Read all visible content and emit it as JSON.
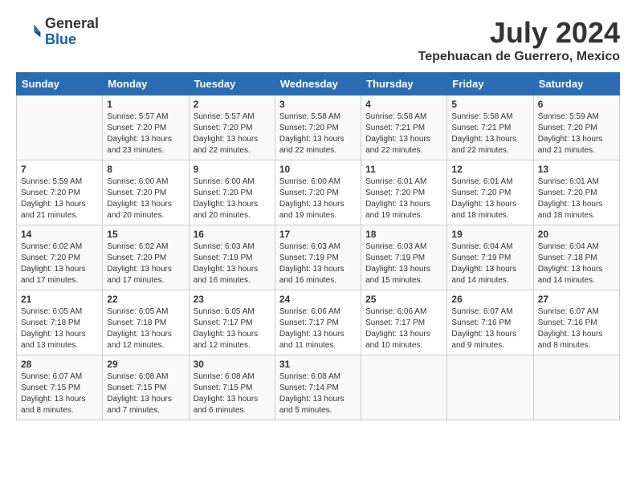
{
  "logo": {
    "general": "General",
    "blue": "Blue"
  },
  "header": {
    "month_year": "July 2024",
    "location": "Tepehuacan de Guerrero, Mexico"
  },
  "days_of_week": [
    "Sunday",
    "Monday",
    "Tuesday",
    "Wednesday",
    "Thursday",
    "Friday",
    "Saturday"
  ],
  "weeks": [
    [
      {
        "day": "",
        "info": ""
      },
      {
        "day": "1",
        "info": "Sunrise: 5:57 AM\nSunset: 7:20 PM\nDaylight: 13 hours\nand 23 minutes."
      },
      {
        "day": "2",
        "info": "Sunrise: 5:57 AM\nSunset: 7:20 PM\nDaylight: 13 hours\nand 22 minutes."
      },
      {
        "day": "3",
        "info": "Sunrise: 5:58 AM\nSunset: 7:20 PM\nDaylight: 13 hours\nand 22 minutes."
      },
      {
        "day": "4",
        "info": "Sunrise: 5:58 AM\nSunset: 7:21 PM\nDaylight: 13 hours\nand 22 minutes."
      },
      {
        "day": "5",
        "info": "Sunrise: 5:58 AM\nSunset: 7:21 PM\nDaylight: 13 hours\nand 22 minutes."
      },
      {
        "day": "6",
        "info": "Sunrise: 5:59 AM\nSunset: 7:20 PM\nDaylight: 13 hours\nand 21 minutes."
      }
    ],
    [
      {
        "day": "7",
        "info": "Sunrise: 5:59 AM\nSunset: 7:20 PM\nDaylight: 13 hours\nand 21 minutes."
      },
      {
        "day": "8",
        "info": "Sunrise: 6:00 AM\nSunset: 7:20 PM\nDaylight: 13 hours\nand 20 minutes."
      },
      {
        "day": "9",
        "info": "Sunrise: 6:00 AM\nSunset: 7:20 PM\nDaylight: 13 hours\nand 20 minutes."
      },
      {
        "day": "10",
        "info": "Sunrise: 6:00 AM\nSunset: 7:20 PM\nDaylight: 13 hours\nand 19 minutes."
      },
      {
        "day": "11",
        "info": "Sunrise: 6:01 AM\nSunset: 7:20 PM\nDaylight: 13 hours\nand 19 minutes."
      },
      {
        "day": "12",
        "info": "Sunrise: 6:01 AM\nSunset: 7:20 PM\nDaylight: 13 hours\nand 18 minutes."
      },
      {
        "day": "13",
        "info": "Sunrise: 6:01 AM\nSunset: 7:20 PM\nDaylight: 13 hours\nand 18 minutes."
      }
    ],
    [
      {
        "day": "14",
        "info": "Sunrise: 6:02 AM\nSunset: 7:20 PM\nDaylight: 13 hours\nand 17 minutes."
      },
      {
        "day": "15",
        "info": "Sunrise: 6:02 AM\nSunset: 7:20 PM\nDaylight: 13 hours\nand 17 minutes."
      },
      {
        "day": "16",
        "info": "Sunrise: 6:03 AM\nSunset: 7:19 PM\nDaylight: 13 hours\nand 16 minutes."
      },
      {
        "day": "17",
        "info": "Sunrise: 6:03 AM\nSunset: 7:19 PM\nDaylight: 13 hours\nand 16 minutes."
      },
      {
        "day": "18",
        "info": "Sunrise: 6:03 AM\nSunset: 7:19 PM\nDaylight: 13 hours\nand 15 minutes."
      },
      {
        "day": "19",
        "info": "Sunrise: 6:04 AM\nSunset: 7:19 PM\nDaylight: 13 hours\nand 14 minutes."
      },
      {
        "day": "20",
        "info": "Sunrise: 6:04 AM\nSunset: 7:18 PM\nDaylight: 13 hours\nand 14 minutes."
      }
    ],
    [
      {
        "day": "21",
        "info": "Sunrise: 6:05 AM\nSunset: 7:18 PM\nDaylight: 13 hours\nand 13 minutes."
      },
      {
        "day": "22",
        "info": "Sunrise: 6:05 AM\nSunset: 7:18 PM\nDaylight: 13 hours\nand 12 minutes."
      },
      {
        "day": "23",
        "info": "Sunrise: 6:05 AM\nSunset: 7:17 PM\nDaylight: 13 hours\nand 12 minutes."
      },
      {
        "day": "24",
        "info": "Sunrise: 6:06 AM\nSunset: 7:17 PM\nDaylight: 13 hours\nand 11 minutes."
      },
      {
        "day": "25",
        "info": "Sunrise: 6:06 AM\nSunset: 7:17 PM\nDaylight: 13 hours\nand 10 minutes."
      },
      {
        "day": "26",
        "info": "Sunrise: 6:07 AM\nSunset: 7:16 PM\nDaylight: 13 hours\nand 9 minutes."
      },
      {
        "day": "27",
        "info": "Sunrise: 6:07 AM\nSunset: 7:16 PM\nDaylight: 13 hours\nand 8 minutes."
      }
    ],
    [
      {
        "day": "28",
        "info": "Sunrise: 6:07 AM\nSunset: 7:15 PM\nDaylight: 13 hours\nand 8 minutes."
      },
      {
        "day": "29",
        "info": "Sunrise: 6:08 AM\nSunset: 7:15 PM\nDaylight: 13 hours\nand 7 minutes."
      },
      {
        "day": "30",
        "info": "Sunrise: 6:08 AM\nSunset: 7:15 PM\nDaylight: 13 hours\nand 6 minutes."
      },
      {
        "day": "31",
        "info": "Sunrise: 6:08 AM\nSunset: 7:14 PM\nDaylight: 13 hours\nand 5 minutes."
      },
      {
        "day": "",
        "info": ""
      },
      {
        "day": "",
        "info": ""
      },
      {
        "day": "",
        "info": ""
      }
    ]
  ]
}
